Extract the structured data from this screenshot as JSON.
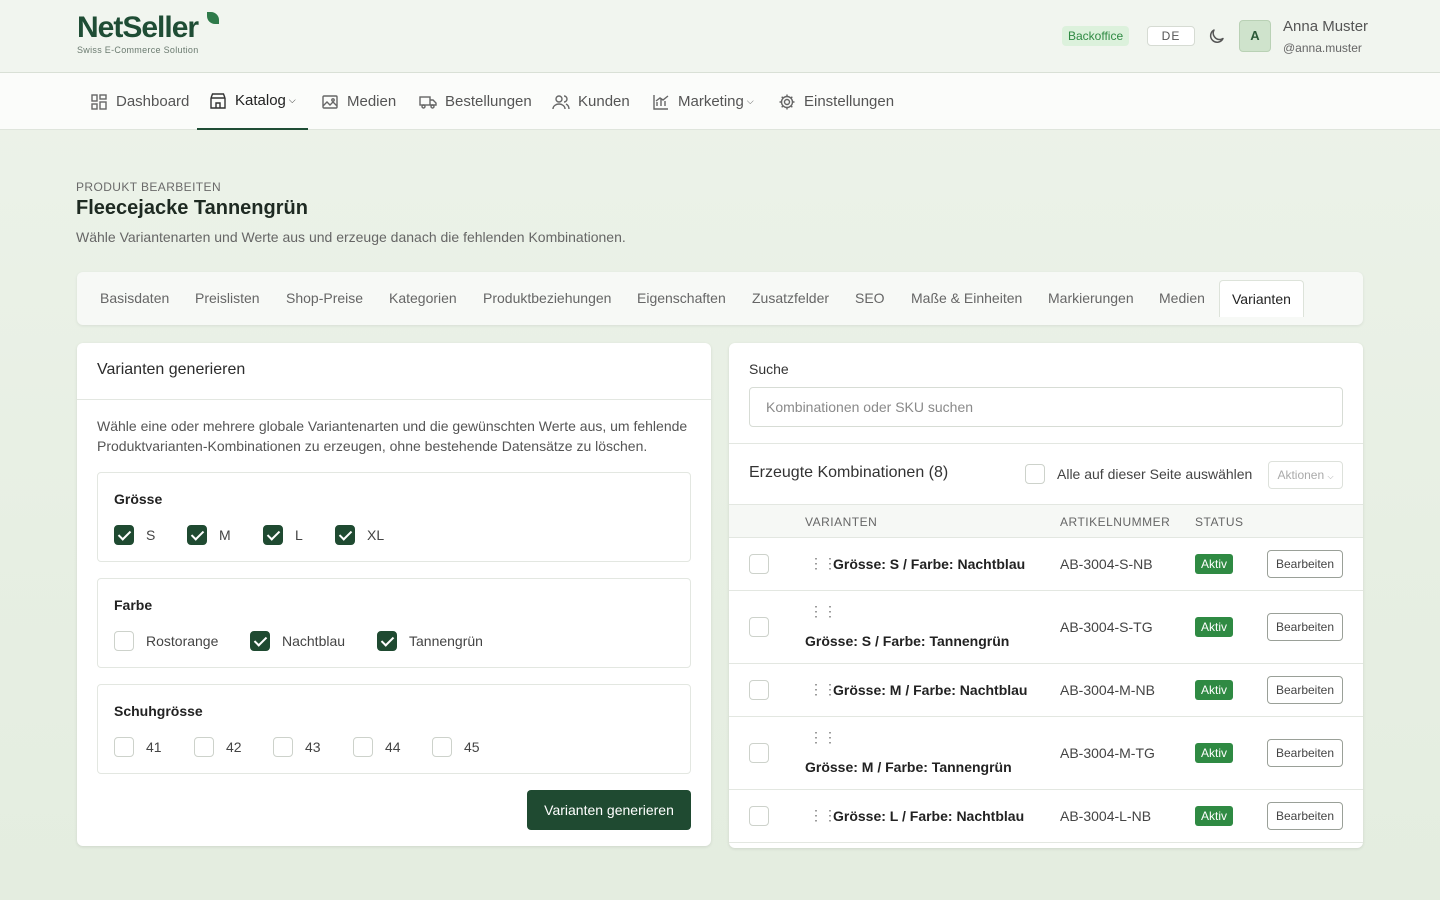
{
  "brand": {
    "name": "NetSeller",
    "tagline": "Swiss E-Commerce Solution"
  },
  "header": {
    "env_badge": "Backoffice",
    "language": "DE",
    "avatar_initial": "A",
    "user_name": "Anna Muster",
    "user_handle": "@anna.muster"
  },
  "nav": {
    "items": [
      {
        "label": "Dashboard",
        "icon": "dashboard-icon"
      },
      {
        "label": "Katalog",
        "icon": "store-icon",
        "active": true,
        "dropdown": true
      },
      {
        "label": "Medien",
        "icon": "image-icon"
      },
      {
        "label": "Bestellungen",
        "icon": "truck-icon"
      },
      {
        "label": "Kunden",
        "icon": "users-icon"
      },
      {
        "label": "Marketing",
        "icon": "chart-icon",
        "dropdown": true
      },
      {
        "label": "Einstellungen",
        "icon": "gear-icon"
      }
    ]
  },
  "page": {
    "kicker": "PRODUKT BEARBEITEN",
    "title": "Fleecejacke Tannengrün",
    "subtitle": "Wähle Variantenarten und Werte aus und erzeuge danach die fehlenden Kombinationen."
  },
  "tabs": [
    "Basisdaten",
    "Preislisten",
    "Shop-Preise",
    "Kategorien",
    "Produktbeziehungen",
    "Eigenschaften",
    "Zusatzfelder",
    "SEO",
    "Maße & Einheiten",
    "Markierungen",
    "Medien",
    "Varianten"
  ],
  "active_tab": "Varianten",
  "generator": {
    "title": "Varianten generieren",
    "intro": "Wähle eine oder mehrere globale Variantenarten und die gewünschten Werte aus, um fehlende Produktvarianten-Kombinationen zu erzeugen, ohne bestehende Datensätze zu löschen.",
    "groups": [
      {
        "name": "Grösse",
        "options": [
          {
            "label": "S",
            "checked": true
          },
          {
            "label": "M",
            "checked": true
          },
          {
            "label": "L",
            "checked": true
          },
          {
            "label": "XL",
            "checked": true
          }
        ]
      },
      {
        "name": "Farbe",
        "options": [
          {
            "label": "Rostorange",
            "checked": false
          },
          {
            "label": "Nachtblau",
            "checked": true
          },
          {
            "label": "Tannengrün",
            "checked": true
          }
        ]
      },
      {
        "name": "Schuhgrösse",
        "options": [
          {
            "label": "41",
            "checked": false
          },
          {
            "label": "42",
            "checked": false
          },
          {
            "label": "43",
            "checked": false
          },
          {
            "label": "44",
            "checked": false
          },
          {
            "label": "45",
            "checked": false
          }
        ]
      }
    ],
    "button": "Varianten generieren"
  },
  "combinations": {
    "search_label": "Suche",
    "search_placeholder": "Kombinationen oder SKU suchen",
    "title": "Erzeugte Kombinationen (8)",
    "select_all": "Alle auf dieser Seite auswählen",
    "actions": "Aktionen",
    "columns": [
      "VARIANTEN",
      "ARTIKELNUMMER",
      "STATUS"
    ],
    "rows": [
      {
        "variant": "Grösse: S / Farbe: Nachtblau",
        "sku": "AB-3004-S-NB",
        "status": "Aktiv",
        "edit": "Bearbeiten"
      },
      {
        "variant": "Grösse: S / Farbe: Tannengrün",
        "sku": "AB-3004-S-TG",
        "status": "Aktiv",
        "edit": "Bearbeiten"
      },
      {
        "variant": "Grösse: M / Farbe: Nachtblau",
        "sku": "AB-3004-M-NB",
        "status": "Aktiv",
        "edit": "Bearbeiten"
      },
      {
        "variant": "Grösse: M / Farbe: Tannengrün",
        "sku": "AB-3004-M-TG",
        "status": "Aktiv",
        "edit": "Bearbeiten"
      },
      {
        "variant": "Grösse: L / Farbe: Nachtblau",
        "sku": "AB-3004-L-NB",
        "status": "Aktiv",
        "edit": "Bearbeiten"
      }
    ]
  },
  "colors": {
    "brand": "#1f4d35",
    "primary_button": "#1f4a31",
    "status_active": "#2f8a43"
  }
}
